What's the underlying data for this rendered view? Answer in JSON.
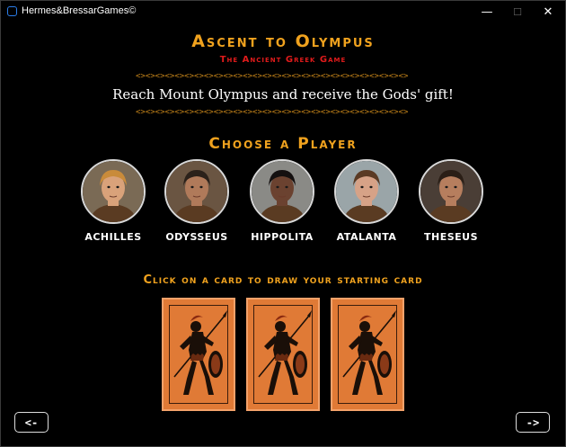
{
  "window": {
    "title": "Hermes&BressarGames©",
    "minimize": "—",
    "maximize": "☐",
    "close": "✕"
  },
  "header": {
    "title": "Ascent to Olympus",
    "subtitle": "The Ancient Greek Game",
    "border_pattern": "<><><><><><><><><><><><><><><><><><><><><><><><><><><><>",
    "tagline": "Reach Mount Olympus and receive the Gods' gift!"
  },
  "choose_player": {
    "heading": "Choose a Player",
    "players": [
      {
        "name": "ACHILLES",
        "hair": "#c98b3a",
        "skin": "#d9a27a",
        "bg": "#7a6a55"
      },
      {
        "name": "ODYSSEUS",
        "hair": "#2b211a",
        "skin": "#b07a5a",
        "bg": "#6a5542"
      },
      {
        "name": "HIPPOLITA",
        "hair": "#141010",
        "skin": "#6b4230",
        "bg": "#8a8a86"
      },
      {
        "name": "ATALANTA",
        "hair": "#5a3a24",
        "skin": "#d6a287",
        "bg": "#9aa5a8"
      },
      {
        "name": "THESEUS",
        "hair": "#2a1e16",
        "skin": "#b67e5e",
        "bg": "#4a3e36"
      }
    ]
  },
  "cards": {
    "instruction": "Click on a card to draw your starting card",
    "count": 3,
    "color": "#e07a36"
  },
  "nav": {
    "back_label": "<-",
    "next_label": "->"
  }
}
